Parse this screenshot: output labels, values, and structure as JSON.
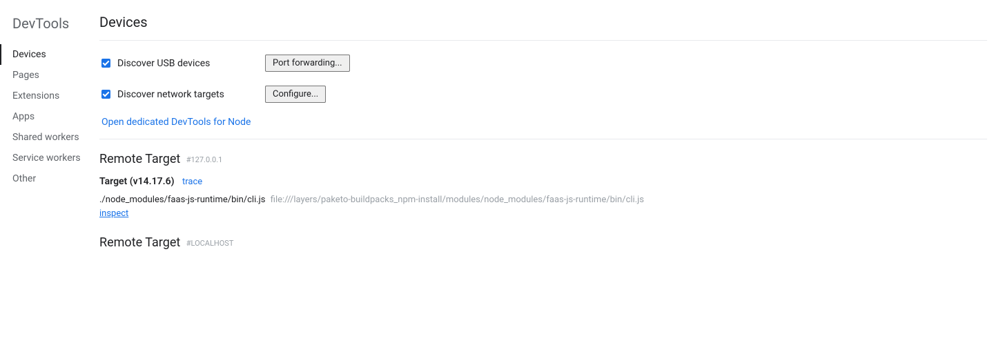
{
  "sidebar": {
    "title": "DevTools",
    "items": [
      {
        "label": "Devices",
        "active": true
      },
      {
        "label": "Pages",
        "active": false
      },
      {
        "label": "Extensions",
        "active": false
      },
      {
        "label": "Apps",
        "active": false
      },
      {
        "label": "Shared workers",
        "active": false
      },
      {
        "label": "Service workers",
        "active": false
      },
      {
        "label": "Other",
        "active": false
      }
    ]
  },
  "page": {
    "title": "Devices"
  },
  "settings": {
    "usb_label": "Discover USB devices",
    "port_forwarding_btn": "Port forwarding...",
    "network_label": "Discover network targets",
    "configure_btn": "Configure...",
    "node_link": "Open dedicated DevTools for Node"
  },
  "remote1": {
    "title": "Remote Target",
    "hash": "#127.0.0.1",
    "target_name": "Target (v14.17.6)",
    "trace": "trace",
    "path_short": "./node_modules/faas-js-runtime/bin/cli.js",
    "path_full": "file:///layers/paketo-buildpacks_npm-install/modules/node_modules/faas-js-runtime/bin/cli.js",
    "inspect": "inspect"
  },
  "remote2": {
    "title": "Remote Target",
    "hash": "#LOCALHOST"
  }
}
